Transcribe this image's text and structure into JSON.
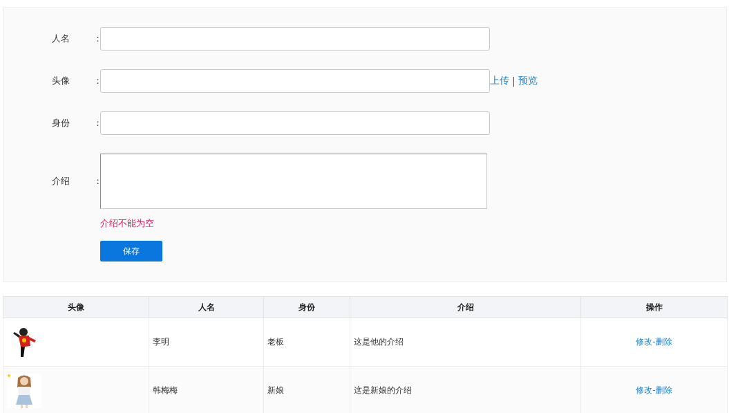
{
  "form": {
    "fields": [
      {
        "label": "人名",
        "colon": "：",
        "kind": "text"
      },
      {
        "label": "头像",
        "colon": "：",
        "kind": "text",
        "links": [
          "上传",
          "预览"
        ],
        "link_separator": "|"
      },
      {
        "label": "身份",
        "colon": "：",
        "kind": "text"
      },
      {
        "label": "介绍",
        "colon": "：",
        "kind": "textarea"
      }
    ],
    "error": "介绍不能为空",
    "save_button": "保存"
  },
  "table": {
    "columns": [
      "头像",
      "人名",
      "身份",
      "介绍",
      "操作"
    ],
    "rows": [
      {
        "name": "李明",
        "role": "老板",
        "intro": "这是他的介绍",
        "edit": "修改",
        "separator": "-",
        "delete": "删除"
      },
      {
        "name": "韩梅梅",
        "role": "新娘",
        "intro": "这是新娘的介绍",
        "edit": "修改",
        "separator": "-",
        "delete": "删除"
      }
    ]
  }
}
